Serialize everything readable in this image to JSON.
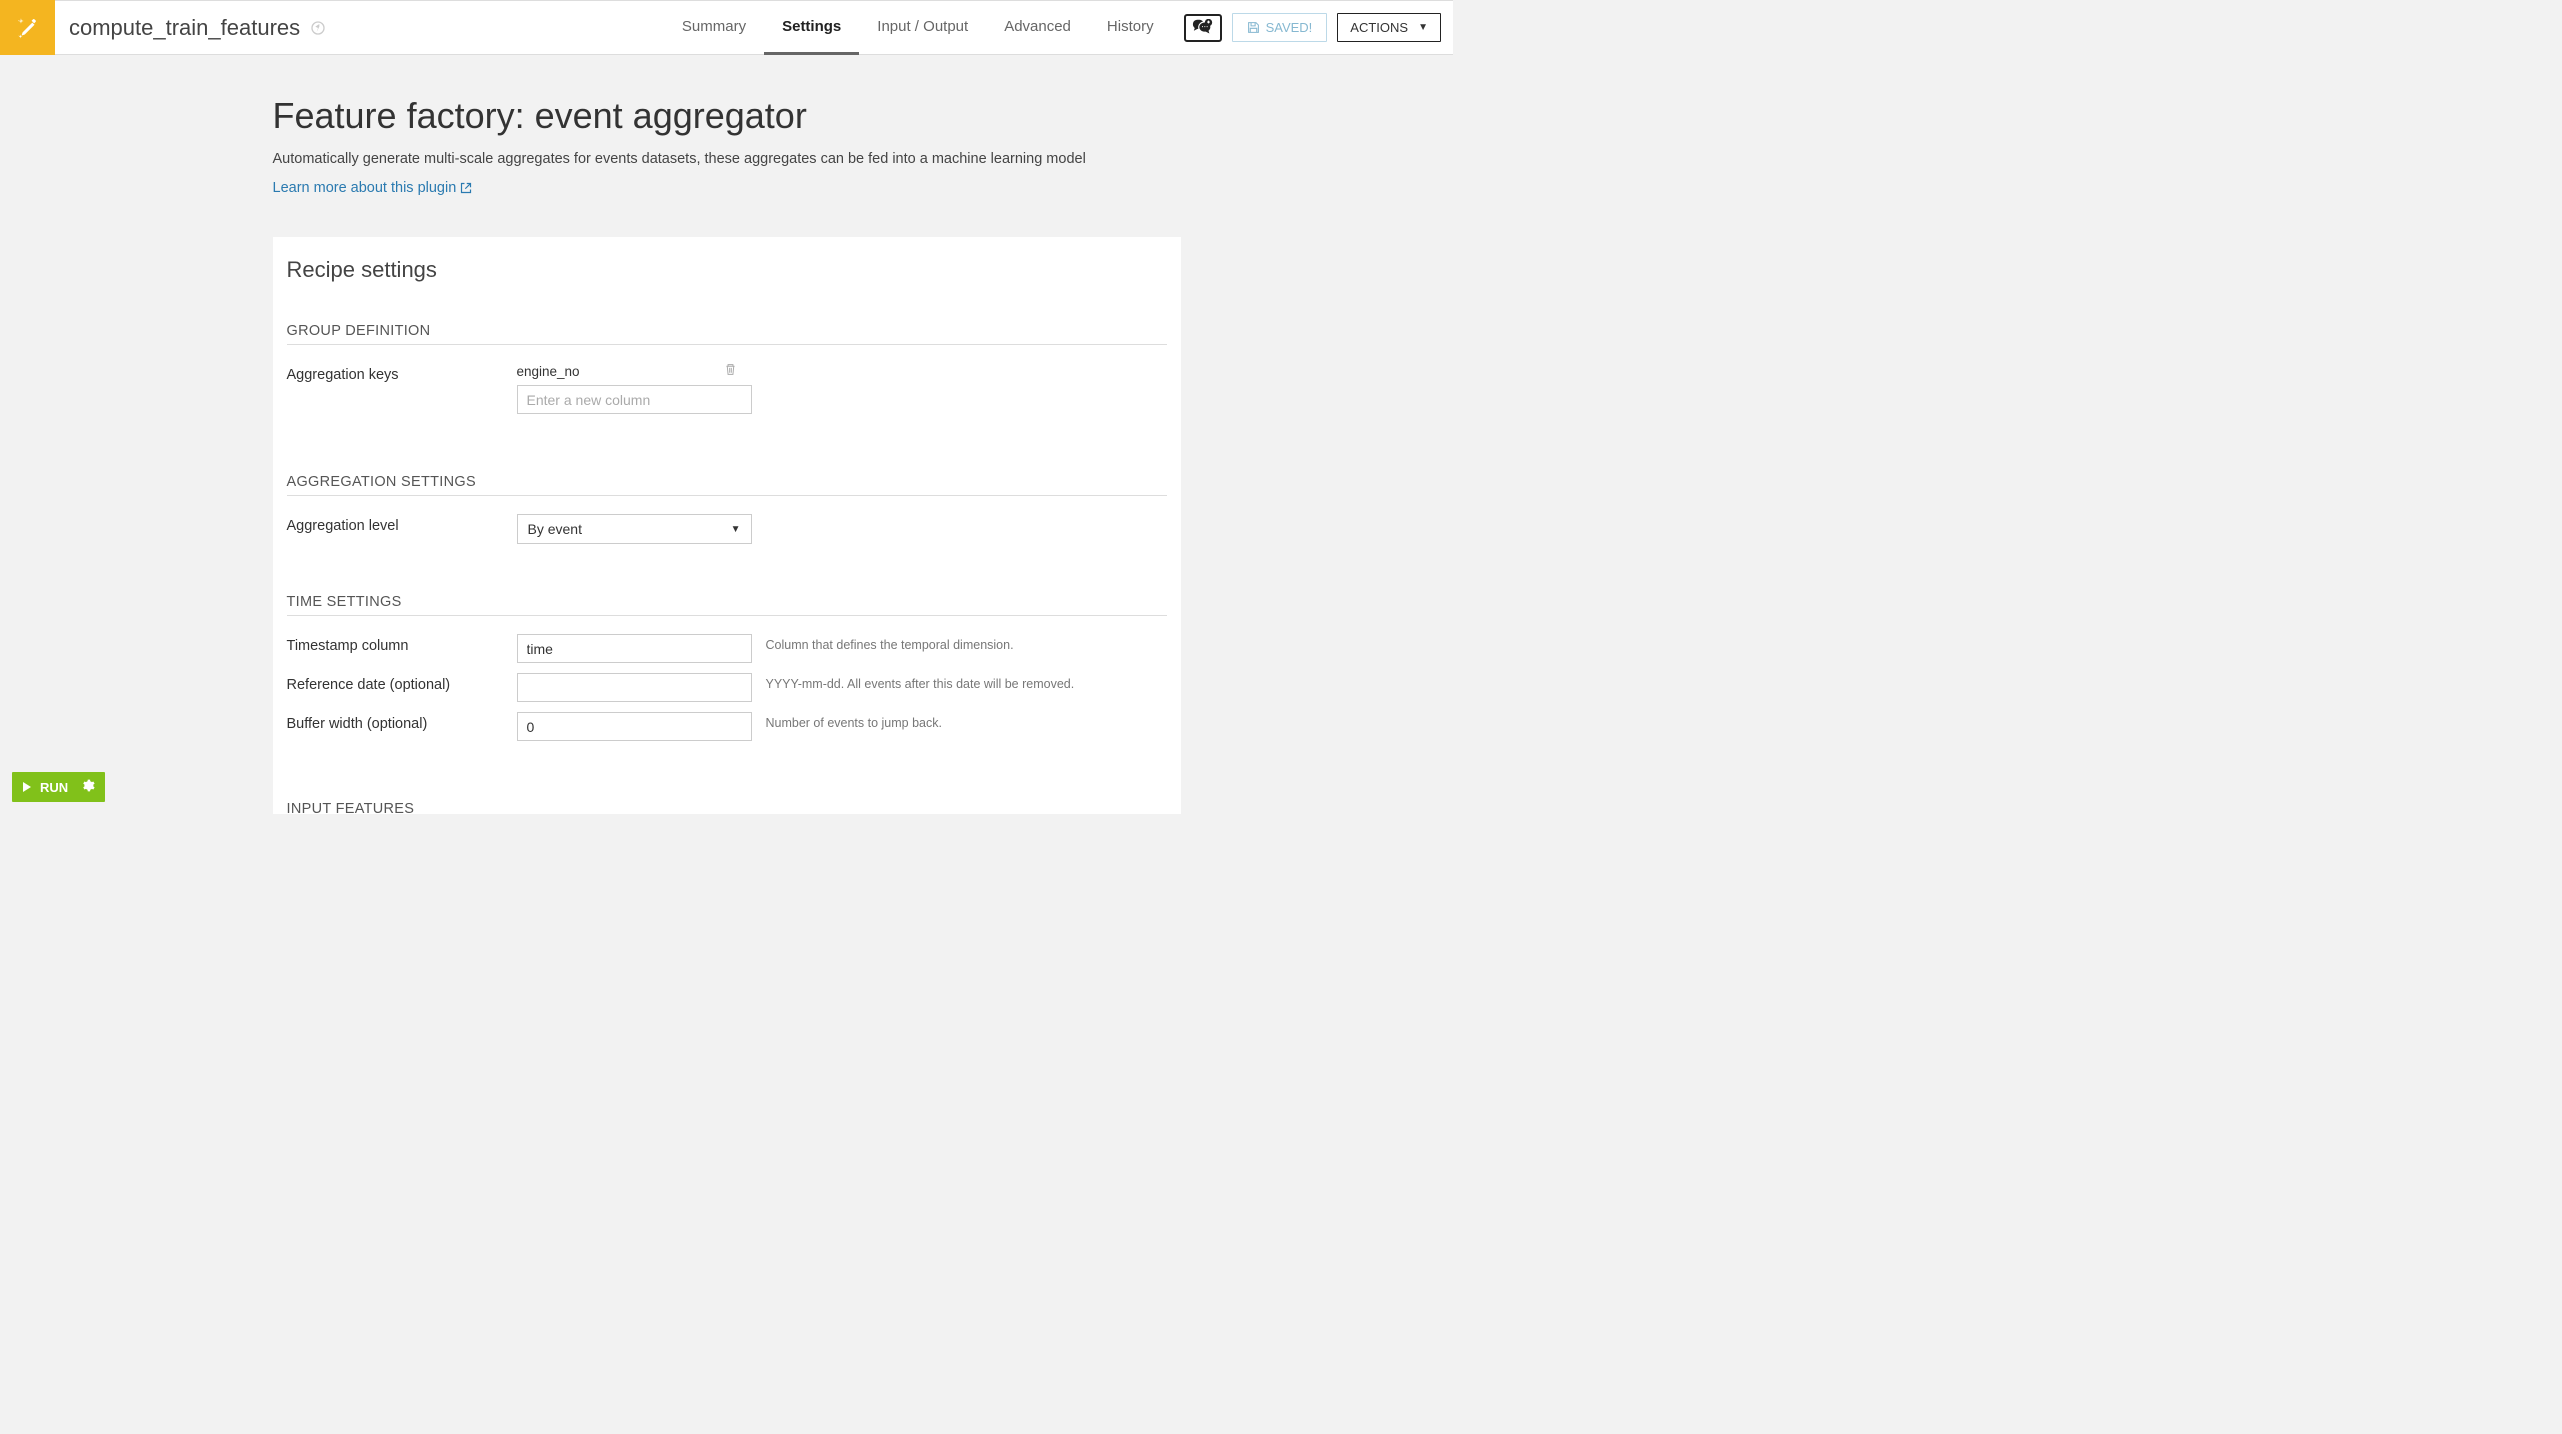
{
  "header": {
    "title": "compute_train_features",
    "tabs": [
      {
        "label": "Summary",
        "active": false
      },
      {
        "label": "Settings",
        "active": true
      },
      {
        "label": "Input / Output",
        "active": false
      },
      {
        "label": "Advanced",
        "active": false
      },
      {
        "label": "History",
        "active": false
      }
    ],
    "saved_label": "SAVED!",
    "actions_label": "ACTIONS"
  },
  "main": {
    "heading": "Feature factory: event aggregator",
    "subtitle": "Automatically generate multi-scale aggregates for events datasets, these aggregates can be fed into a machine learning model",
    "learn_more": "Learn more about this plugin"
  },
  "panel": {
    "title": "Recipe settings"
  },
  "group_definition": {
    "heading": "GROUP DEFINITION",
    "aggregation_keys_label": "Aggregation keys",
    "keys": [
      "engine_no"
    ],
    "new_column_placeholder": "Enter a new column"
  },
  "aggregation_settings": {
    "heading": "AGGREGATION SETTINGS",
    "level_label": "Aggregation level",
    "level_value": "By event"
  },
  "time_settings": {
    "heading": "TIME SETTINGS",
    "timestamp_label": "Timestamp column",
    "timestamp_value": "time",
    "timestamp_hint": "Column that defines the temporal dimension.",
    "reference_label": "Reference date (optional)",
    "reference_value": "",
    "reference_hint": "YYYY-mm-dd. All events after this date will be removed.",
    "buffer_label": "Buffer width (optional)",
    "buffer_value": "0",
    "buffer_hint": "Number of events to jump back."
  },
  "input_features": {
    "heading": "INPUT FEATURES"
  },
  "run_label": "RUN"
}
